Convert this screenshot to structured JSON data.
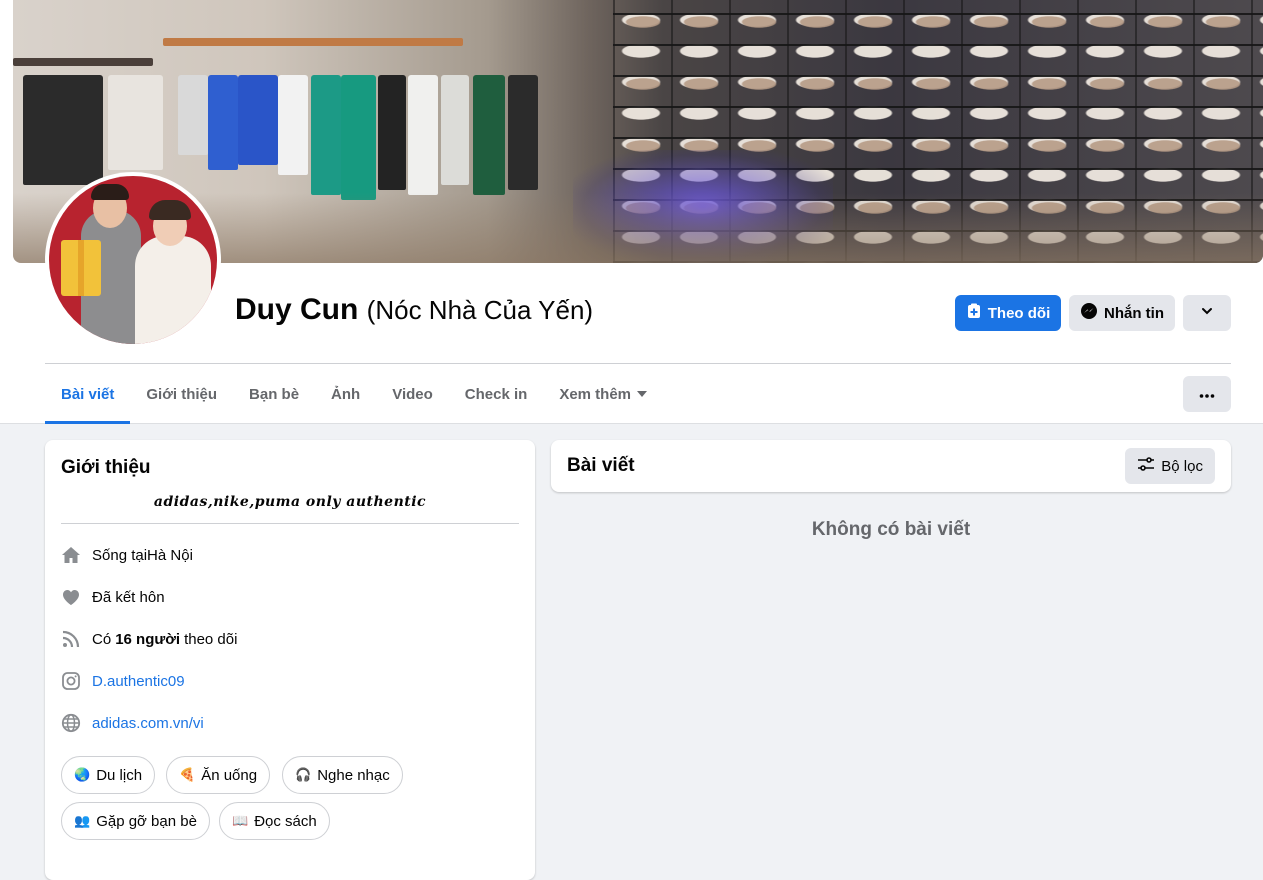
{
  "profile": {
    "name": "Duy Cun",
    "alternate_name": "(Nóc Nhà Của Yến)"
  },
  "actions": {
    "follow_label": "Theo dõi",
    "message_label": "Nhắn tin"
  },
  "tabs": [
    {
      "label": "Bài viết"
    },
    {
      "label": "Giới thiệu"
    },
    {
      "label": "Bạn bè"
    },
    {
      "label": "Ảnh"
    },
    {
      "label": "Video"
    },
    {
      "label": "Check in"
    },
    {
      "label": "Xem thêm"
    }
  ],
  "intro": {
    "title": "Giới thiệu",
    "bio": "adidas,nike,puma only authentic",
    "lives_prefix": "Sống tại ",
    "lives_city": "Hà Nội",
    "relationship": "Đã kết hôn",
    "followers_prefix": "Có ",
    "followers_count": "16 người",
    "followers_suffix": " theo dõi",
    "instagram": "D.authentic09",
    "website": "adidas.com.vn/vi",
    "hobbies": [
      {
        "emoji": "🌏",
        "label": "Du lịch"
      },
      {
        "emoji": "🍕",
        "label": "Ăn uống"
      },
      {
        "emoji": "🎧",
        "label": "Nghe nhạc"
      },
      {
        "emoji": "👥",
        "label": "Gặp gỡ bạn bè"
      },
      {
        "emoji": "📖",
        "label": "Đọc sách"
      }
    ]
  },
  "posts": {
    "title": "Bài viết",
    "filter_label": "Bộ lọc",
    "empty_text": "Không có bài viết"
  },
  "colors": {
    "accent": "#1b74e4",
    "background": "#f0f2f5",
    "secondary_button": "#e4e6eb",
    "muted_text": "#65676b"
  }
}
